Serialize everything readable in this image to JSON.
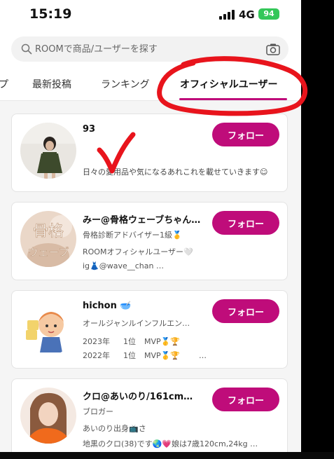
{
  "status_bar": {
    "time": "15:19",
    "network": "4G",
    "battery": "94"
  },
  "search": {
    "placeholder": "ROOMで商品/ユーザーを探す"
  },
  "tabs": [
    "プ",
    "最新投稿",
    "ランキング",
    "オフィシャルユーザー"
  ],
  "active_tab_index": 3,
  "users": [
    {
      "name": "93",
      "lines": [
        "日々の愛用品や気になるあれこれを載せていきます☺"
      ],
      "follow_label": "フォロー"
    },
    {
      "name": "みー@骨格ウェーブちゃん…",
      "avatar_text_1": "骨格",
      "avatar_text_2": "ウェーブ",
      "lines": [
        "骨格診断アドバイザー1級🥇",
        "ROOMオフィシャルユーザー🤍",
        "ig👗@wave__chan …"
      ],
      "follow_label": "フォロー"
    },
    {
      "name": "hichon 🥣",
      "lines": [
        "オールジャンルインフルエン…"
      ],
      "stats": [
        {
          "year": "2023年",
          "rank": "1位",
          "award": "MVP🥇🏆"
        },
        {
          "year": "2022年",
          "rank": "1位",
          "award": "MVP🥇🏆",
          "more": "…"
        }
      ],
      "follow_label": "フォロー"
    },
    {
      "name": "クロ@あいのり/161cm…",
      "lines": [
        "ブロガー",
        "あいのり出身📺さ",
        "地黒のクロ(38)です🌏💗娘は7歳120cm,24kg …"
      ],
      "follow_label": "フォロー"
    }
  ],
  "colors": {
    "accent": "#bf0c7a",
    "annotation": "#e8141c"
  }
}
